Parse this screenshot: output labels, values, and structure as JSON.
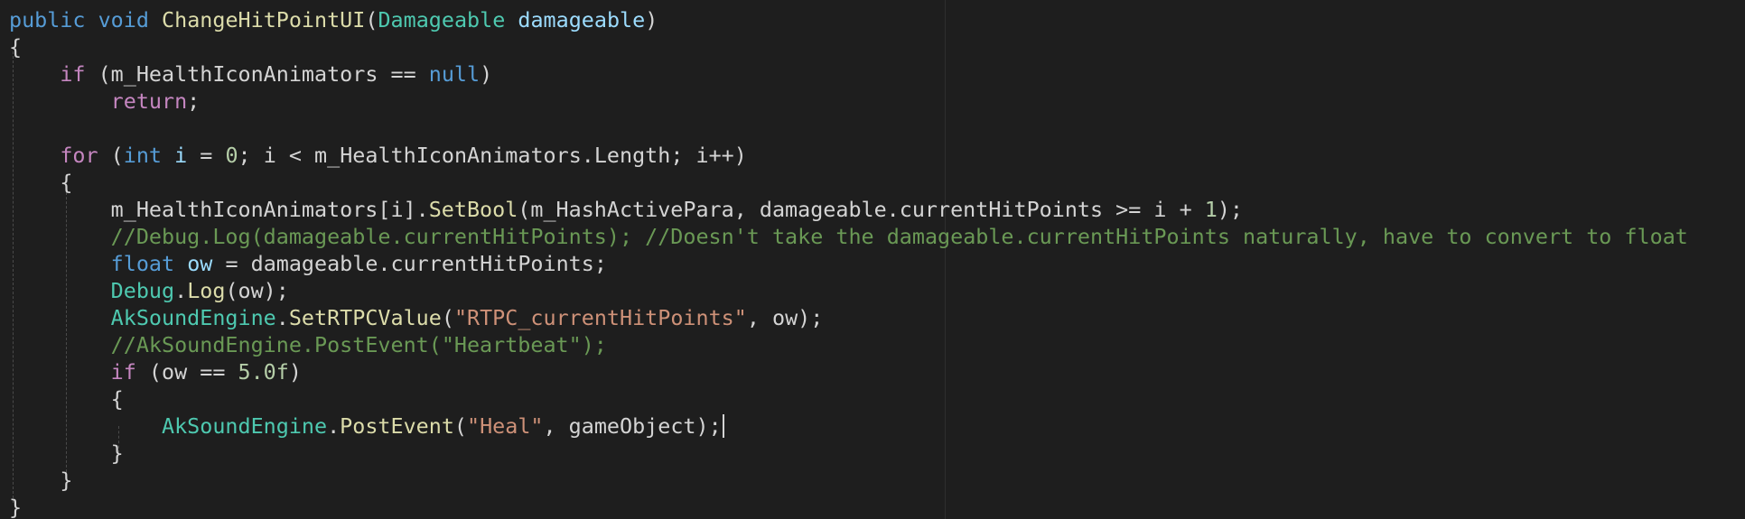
{
  "editor": {
    "language": "C#",
    "lines": [
      [
        [
          "kw",
          "public"
        ],
        [
          "plain",
          " "
        ],
        [
          "kw",
          "void"
        ],
        [
          "plain",
          " "
        ],
        [
          "fn",
          "ChangeHitPointUI"
        ],
        [
          "plain",
          "("
        ],
        [
          "type",
          "Damageable"
        ],
        [
          "plain",
          " "
        ],
        [
          "param",
          "damageable"
        ],
        [
          "plain",
          ")"
        ]
      ],
      [
        [
          "plain",
          "{"
        ]
      ],
      [
        [
          "plain",
          "    "
        ],
        [
          "ctl",
          "if"
        ],
        [
          "plain",
          " (m_HealthIconAnimators == "
        ],
        [
          "kw",
          "null"
        ],
        [
          "plain",
          ")"
        ]
      ],
      [
        [
          "plain",
          "        "
        ],
        [
          "ctl",
          "return"
        ],
        [
          "plain",
          ";"
        ]
      ],
      [],
      [
        [
          "plain",
          "    "
        ],
        [
          "ctl",
          "for"
        ],
        [
          "plain",
          " ("
        ],
        [
          "kw",
          "int"
        ],
        [
          "plain",
          " "
        ],
        [
          "param",
          "i"
        ],
        [
          "plain",
          " = "
        ],
        [
          "num",
          "0"
        ],
        [
          "plain",
          "; i < m_HealthIconAnimators.Length; i++)"
        ]
      ],
      [
        [
          "plain",
          "    {"
        ]
      ],
      [
        [
          "plain",
          "        m_HealthIconAnimators[i]."
        ],
        [
          "fn",
          "SetBool"
        ],
        [
          "plain",
          "(m_HashActivePara, damageable.currentHitPoints >= i + "
        ],
        [
          "num",
          "1"
        ],
        [
          "plain",
          ");"
        ]
      ],
      [
        [
          "plain",
          "        "
        ],
        [
          "cmt",
          "//Debug.Log(damageable.currentHitPoints); //Doesn't take the damageable.currentHitPoints naturally, have to convert to float"
        ]
      ],
      [
        [
          "plain",
          "        "
        ],
        [
          "kw",
          "float"
        ],
        [
          "plain",
          " "
        ],
        [
          "param",
          "ow"
        ],
        [
          "plain",
          " = damageable.currentHitPoints;"
        ]
      ],
      [
        [
          "plain",
          "        "
        ],
        [
          "type",
          "Debug"
        ],
        [
          "plain",
          "."
        ],
        [
          "fn",
          "Log"
        ],
        [
          "plain",
          "(ow);"
        ]
      ],
      [
        [
          "plain",
          "        "
        ],
        [
          "type",
          "AkSoundEngine"
        ],
        [
          "plain",
          "."
        ],
        [
          "fn",
          "SetRTPCValue"
        ],
        [
          "plain",
          "("
        ],
        [
          "str",
          "\"RTPC_currentHitPoints\""
        ],
        [
          "plain",
          ", ow);"
        ]
      ],
      [
        [
          "plain",
          "        "
        ],
        [
          "cmt",
          "//AkSoundEngine.PostEvent(\"Heartbeat\");"
        ]
      ],
      [
        [
          "plain",
          "        "
        ],
        [
          "ctl",
          "if"
        ],
        [
          "plain",
          " (ow == "
        ],
        [
          "num",
          "5.0f"
        ],
        [
          "plain",
          ")"
        ]
      ],
      [
        [
          "plain",
          "        {"
        ]
      ],
      [
        [
          "plain",
          "            "
        ],
        [
          "type",
          "AkSoundEngine"
        ],
        [
          "plain",
          "."
        ],
        [
          "fn",
          "PostEvent"
        ],
        [
          "plain",
          "("
        ],
        [
          "str",
          "\"Heal\""
        ],
        [
          "plain",
          ", gameObject);"
        ]
      ],
      [
        [
          "plain",
          "        }"
        ]
      ],
      [
        [
          "plain",
          "    }"
        ]
      ],
      [
        [
          "plain",
          "}"
        ]
      ]
    ],
    "cursor_line": 15
  }
}
